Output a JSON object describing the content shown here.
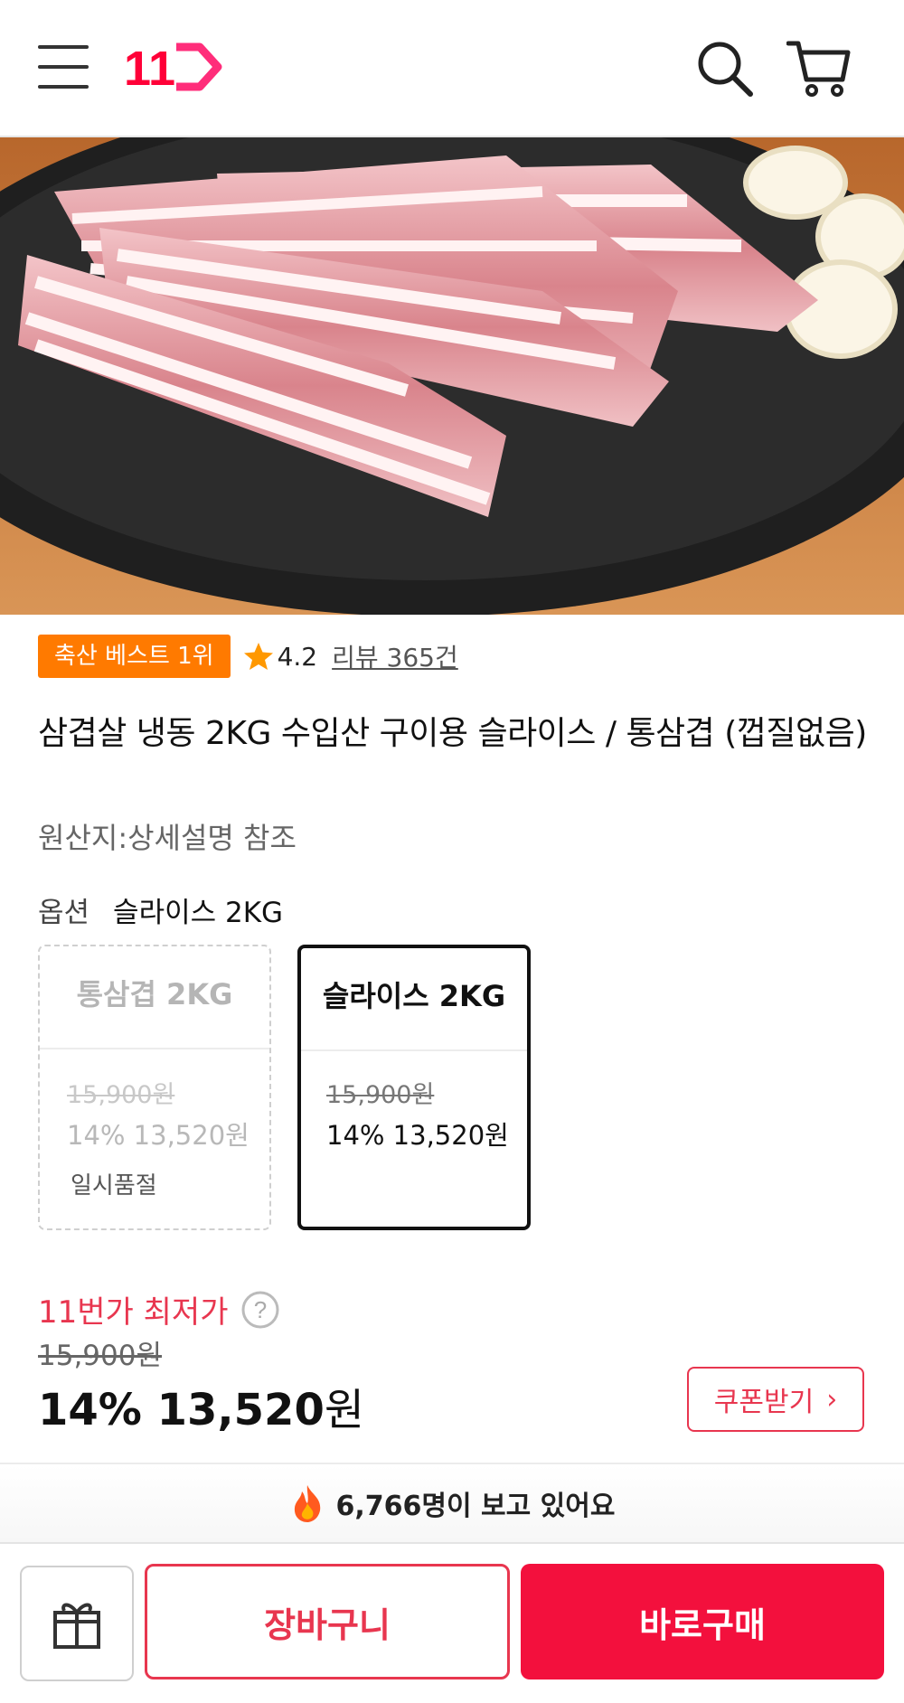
{
  "header": {
    "menu_icon": "hamburger-menu-icon",
    "logo_text": "11",
    "search_icon": "search-icon",
    "cart_icon": "cart-icon",
    "colors": {
      "logo_red": "#ff0038",
      "logo_magenta": "#ff3399"
    }
  },
  "product": {
    "image_alt": "frozen pork belly slices on grill plate",
    "badge": "축산 베스트 1위",
    "rating": "4.2",
    "reviews": "리뷰 365건",
    "title": "삼겹살 냉동 2KG 수입산 구이용 슬라이스 / 통삼겹 (껍질없음)",
    "origin": "원산지:상세설명 참조"
  },
  "options": {
    "label": "옵션",
    "selected": "슬라이스 2KG",
    "items": [
      {
        "name": "통삼겹 2KG",
        "original_price": "15,900원",
        "price": "14% 13,520원",
        "status": "일시품절"
      },
      {
        "name": "슬라이스 2KG",
        "original_price": "15,900원",
        "price": "14% 13,520원"
      }
    ]
  },
  "pricing": {
    "lowest_label": "11번가 최저가",
    "help_icon": "question-circle-icon",
    "original_price": "15,900원",
    "discount": "14%",
    "final_price": "13,520",
    "currency": "원",
    "coupon_label": "쿠폰받기"
  },
  "viewers": {
    "icon": "fire-icon",
    "text": "6,766명이 보고 있어요"
  },
  "bottom_bar": {
    "gift_icon": "gift-icon",
    "cart_label": "장바구니",
    "buy_label": "바로구매",
    "colors": {
      "accent": "#f3103d",
      "badge": "#ff7a00"
    }
  }
}
